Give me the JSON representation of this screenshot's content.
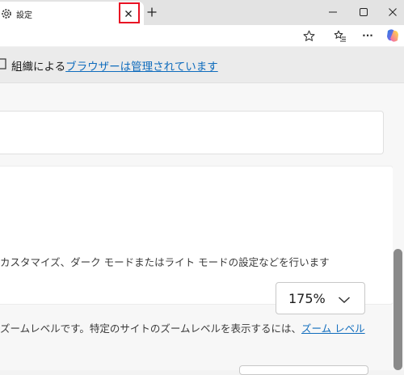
{
  "tab": {
    "title": "設定",
    "close_glyph": "×",
    "new_tab_glyph": "+"
  },
  "window": {
    "minimize_glyph": "−",
    "maximize_glyph": "□",
    "close_glyph": "✕"
  },
  "toolbar": {
    "more_glyph": "···"
  },
  "managed_bar": {
    "prefix": "組織による",
    "link": "ブラウザーは管理されています"
  },
  "appearance": {
    "description": "カスタマイズ、ダーク モードまたはライト モードの設定などを行います"
  },
  "zoom": {
    "value": "175%",
    "description": "ズームレベルです。特定のサイトのズームレベルを表示するには、",
    "link": "ズーム レベル"
  },
  "colors": {
    "accent": "#0f6cbd",
    "highlight": "#e81123"
  }
}
